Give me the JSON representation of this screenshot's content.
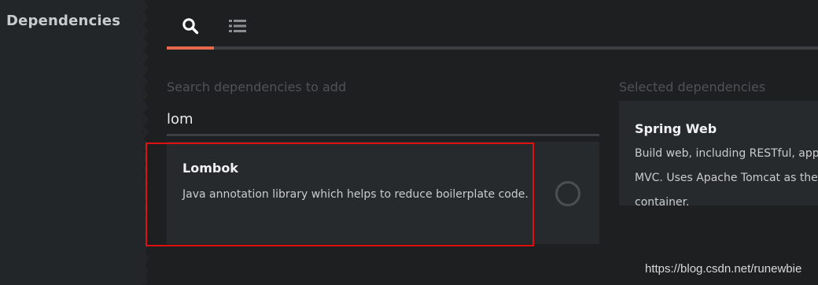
{
  "sidebar": {
    "title": "Dependencies"
  },
  "tabs": [
    {
      "icon": "search-icon",
      "active": true
    },
    {
      "icon": "list-icon",
      "active": false
    }
  ],
  "colors": {
    "accent": "#e86a4a",
    "highlight_box": "#e01010"
  },
  "search": {
    "label": "Search dependencies to add",
    "value": "lom"
  },
  "results": [
    {
      "title": "Lombok",
      "description": "Java annotation library which helps to reduce boilerplate code."
    }
  ],
  "selected": {
    "label": "Selected dependencies",
    "items": [
      {
        "title": "Spring Web",
        "description": "Build web, including RESTful, applications using Spring MVC. Uses Apache Tomcat as the default embedded container."
      }
    ]
  },
  "watermark": "https://blog.csdn.net/runewbie"
}
